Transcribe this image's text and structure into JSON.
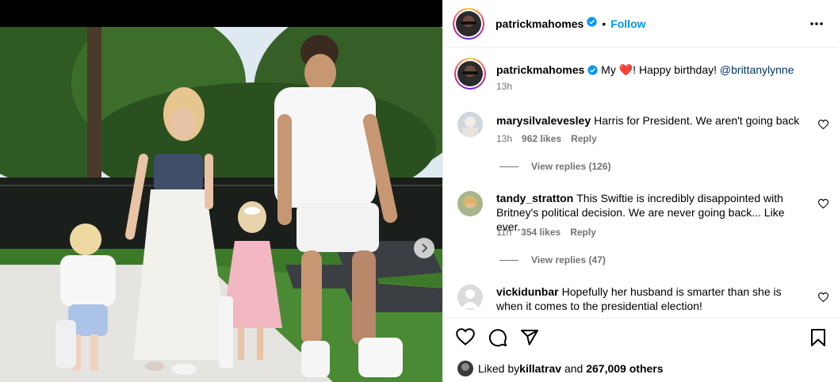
{
  "post": {
    "author": "patrickmahomes",
    "follow_label": "Follow",
    "dot": "•",
    "icons": {
      "verified": "verified-badge-icon",
      "more": "more-options-icon",
      "carousel_next": "chevron-right-icon"
    }
  },
  "caption": {
    "username": "patrickmahomes",
    "text_before": "My ",
    "heart": "❤️",
    "text_after": "! Happy birthday! ",
    "mention": "@brittanylynne",
    "time": "13h"
  },
  "comments": [
    {
      "username": "marysilvalevesley",
      "text": "Harris for President. We aren't going back",
      "time": "13h",
      "likes": "962 likes",
      "reply": "Reply",
      "view_replies": "View replies (126)"
    },
    {
      "username": "tandy_stratton",
      "text": "This Swiftie is incredibly disappointed with Britney's political decision. We are never going back... Like ever.",
      "time": "11h",
      "likes": "354 likes",
      "reply": "Reply",
      "view_replies": "View replies (47)"
    },
    {
      "username": "vickidunbar",
      "text": "Hopefully her husband is smarter than she is when it comes to the presidential election!"
    }
  ],
  "actions": {
    "icons": [
      "heart-icon",
      "comment-icon",
      "share-icon",
      "bookmark-icon"
    ]
  },
  "likes": {
    "prefix": "Liked by ",
    "user": "killatrav",
    "and": " and ",
    "count": "267,009 others"
  },
  "colors": {
    "link": "#0095f6",
    "mention": "#00376b",
    "muted": "#737373",
    "heart_red": "#ed1c24"
  }
}
